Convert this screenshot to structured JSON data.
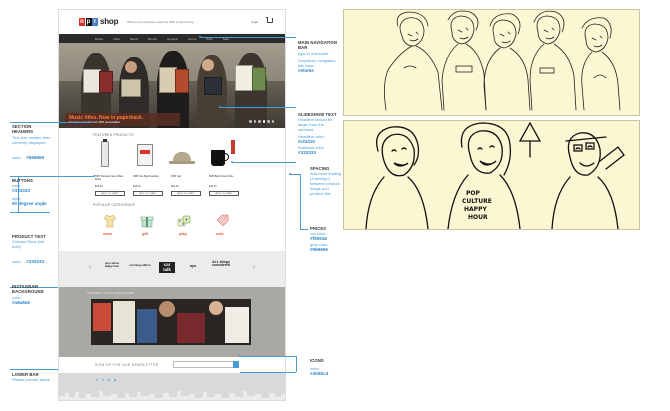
{
  "mockup": {
    "logo_letters": [
      "n",
      "p",
      "r"
    ],
    "logo_shop": "shop",
    "tagline": "Where your purchase supports NPR programming",
    "login": "Login",
    "nav_items": [
      "Radio",
      "Gifts",
      "Music",
      "Books",
      "Apparel",
      "Home",
      "Kids",
      "Sale"
    ],
    "hero_heading": "Music titles. Now in paperback.",
    "hero_sub": "Save five on books from NPR personalities.",
    "featured_heading": "FEATURED PRODUCTS",
    "products": [
      {
        "title": "NPR Stainless Steel Water Bottle",
        "price": "$18.00",
        "button": "ADD TO CART"
      },
      {
        "title": "NPR Tote Bag Reusable",
        "price": "$16.00",
        "button": "ADD TO CART"
      },
      {
        "title": "NPR Cap",
        "price": "$22.00",
        "button": "ADD TO CART"
      },
      {
        "title": "NPR Black Mug Coffee",
        "price": "$15.00",
        "button": "ADD TO CART"
      }
    ],
    "categories_heading": "POPULAR CATEGORIES",
    "categories": [
      "wear",
      "gift",
      "play",
      "sale"
    ],
    "shows": [
      "pop culture happy hour",
      "morning edition",
      "car talk",
      "npr",
      "ALL things considered"
    ],
    "instagram_heading": "SUPPORT US ON INSTAGRAM",
    "newsletter_text": "SIGN UP FOR OUR NEWSLETTER",
    "social_icons": [
      "f",
      "t",
      "y",
      "p"
    ]
  },
  "annotations": {
    "main_nav": {
      "title": "MAIN NAVIGATION BAR",
      "desc": "type in overscale",
      "desc2": "Dropdown navigation bar color:",
      "value": "#ebebe"
    },
    "section_headers": {
      "title": "SECTION HEADERS",
      "desc": "Text size smaller than currently displayed",
      "label": "color:",
      "value": "#666666"
    },
    "buttons": {
      "title": "BUTTONS",
      "desc": "color:",
      "value": "#333333",
      "desc2": "style:",
      "value2": "90 degree angle"
    },
    "product_text": {
      "title": "PRODUCT TEXT",
      "desc": "Gotham Book (not bold)",
      "label": "color:",
      "value": "#333333"
    },
    "instagram": {
      "title": "INSTAGRAM BACKGROUND",
      "label": "color:",
      "value": "#a8a8a6"
    },
    "lower_bar": {
      "title": "LOWER BAR",
      "desc": "Please provide specs"
    },
    "slideshow": {
      "title": "SLIDESHOW TEXT",
      "desc": "Headline should be larger than the subhead",
      "label1": "Headline color:",
      "value1": "#cf4415",
      "label2": "Subhead color:",
      "value2": "#333333"
    },
    "spacing": {
      "title": "SPACING",
      "desc": "Add more leading (Tracking?) between product image and product title"
    },
    "prices": {
      "title": "PRICES",
      "label1": "red color:",
      "value1": "#f90618",
      "label2": "gray color:",
      "value2": "#969696"
    },
    "icons": {
      "title": "ICONS",
      "label": "color:",
      "value": "#4b9bc4"
    }
  },
  "colors": {
    "accent_blue": "#4a9bd4",
    "nav_dark": "#2b2b2b",
    "instagram_bg": "#a9a9a4",
    "sketch_bg": "#fdf6d3",
    "npr_red": "#d6342b",
    "npr_black": "#111111",
    "npr_blue": "#4a82c3"
  }
}
